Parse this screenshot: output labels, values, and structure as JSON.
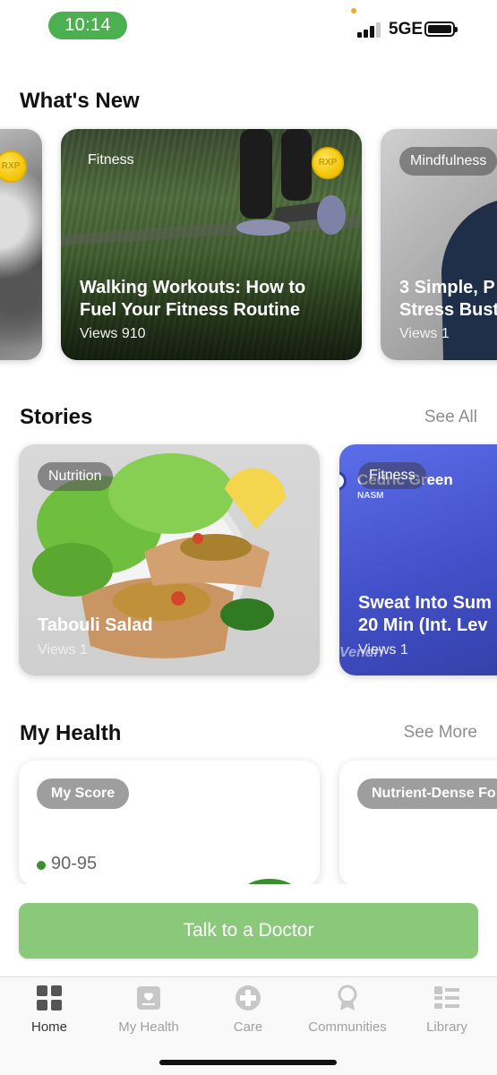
{
  "status_bar": {
    "time": "10:14",
    "network": "5GE"
  },
  "whats_new": {
    "title": "What's New",
    "cards": [
      {
        "tag": "",
        "title": "",
        "views": "",
        "badge": "RXP"
      },
      {
        "tag": "Fitness",
        "title": "Walking Workouts: How to\nFuel Your Fitness Routine",
        "views": "Views 910",
        "badge": "RXP"
      },
      {
        "tag": "Mindfulness",
        "title": "3 Simple, P\nStress Bust",
        "views": "Views 1"
      }
    ]
  },
  "stories": {
    "title": "Stories",
    "see_all": "See All",
    "cards": [
      {
        "tag": "Nutrition",
        "title": "Tabouli Salad",
        "views": "Views 1"
      },
      {
        "tag": "Fitness",
        "overlay_name": "Cedric Green",
        "overlay_sub": "NASM",
        "title": "Sweat Into Sum\n20 Min (Int. Lev",
        "views": "Views 1",
        "watermark": "Vendri"
      }
    ]
  },
  "my_health": {
    "title": "My Health",
    "see_more": "See More",
    "cards": [
      {
        "tag": "My Score",
        "score_range": "90-95",
        "score_color": "#3c8d2f"
      },
      {
        "tag": "Nutrient-Dense Fo"
      }
    ]
  },
  "cta": {
    "label": "Talk to a Doctor"
  },
  "tab_bar": {
    "items": [
      {
        "label": "Home",
        "icon": "grid-icon",
        "active": true
      },
      {
        "label": "My Health",
        "icon": "health-record-icon",
        "active": false
      },
      {
        "label": "Care",
        "icon": "plus-circle-icon",
        "active": false
      },
      {
        "label": "Communities",
        "icon": "ribbon-icon",
        "active": false
      },
      {
        "label": "Library",
        "icon": "list-icon",
        "active": false
      }
    ]
  }
}
